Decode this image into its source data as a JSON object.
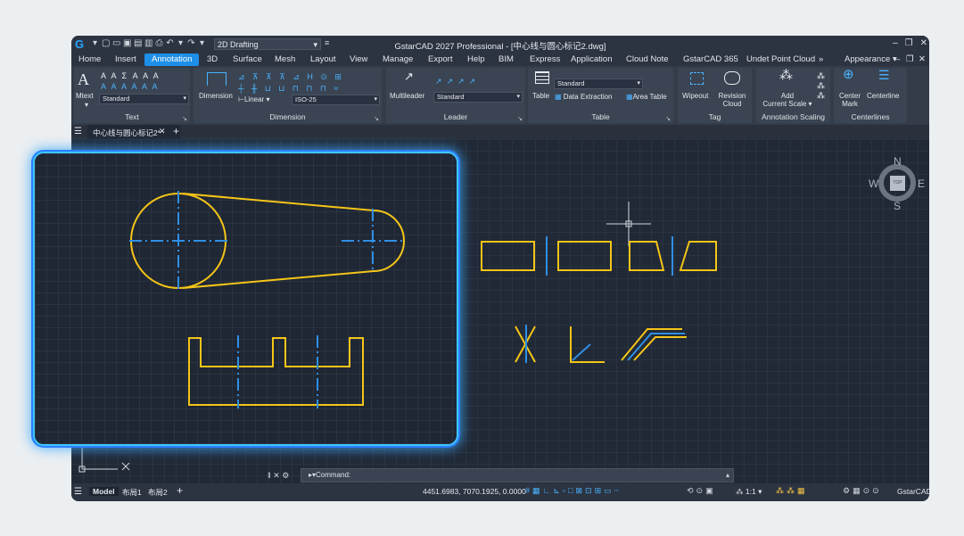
{
  "window": {
    "title": "GstarCAD 2027 Professional - [中心线与圆心标记2.dwg]",
    "workspace": "2D Drafting"
  },
  "menu_tabs": [
    {
      "label": "Home",
      "active": false
    },
    {
      "label": "Insert",
      "active": false
    },
    {
      "label": "Annotation",
      "active": true
    },
    {
      "label": "3D",
      "active": false
    },
    {
      "label": "Surface",
      "active": false
    },
    {
      "label": "Mesh",
      "active": false
    },
    {
      "label": "Layout",
      "active": false
    },
    {
      "label": "View",
      "active": false
    },
    {
      "label": "Manage",
      "active": false
    },
    {
      "label": "Export",
      "active": false
    },
    {
      "label": "Help",
      "active": false
    },
    {
      "label": "BIM",
      "active": false
    },
    {
      "label": "Express",
      "active": false
    },
    {
      "label": "Application",
      "active": false
    },
    {
      "label": "Cloud Note",
      "active": false
    },
    {
      "label": "GstarCAD 365",
      "active": false
    },
    {
      "label": "Undet Point Cloud",
      "active": false
    }
  ],
  "menu_right": {
    "appearance": "Appearance"
  },
  "ribbon": {
    "text": {
      "title": "Text",
      "mtext": "Mtext",
      "style": "Standard"
    },
    "dimension": {
      "title": "Dimension",
      "button": "Dimension",
      "linear": "Linear",
      "style": "ISO-25"
    },
    "leader": {
      "title": "Leader",
      "button": "Multileader",
      "style": "Standard"
    },
    "table": {
      "title": "Table",
      "button": "Table",
      "style": "Standard",
      "data_extraction": "Data Extraction",
      "area_table": "Area Table"
    },
    "tag": {
      "title": "Tag",
      "wipeout": "Wipeout",
      "revision_1": "Revision",
      "revision_2": "Cloud"
    },
    "scaling": {
      "title": "Annotation Scaling",
      "add_1": "Add",
      "add_2": "Current Scale"
    },
    "centerlines": {
      "title": "Centerlines",
      "center_1": "Center",
      "center_2": "Mark",
      "centerline": "Centerline"
    }
  },
  "doc_tab": {
    "label": "中心线与圆心标记2*"
  },
  "viewcube": {
    "n": "N",
    "s": "S",
    "w": "W",
    "e": "E",
    "top": "TOP"
  },
  "command": {
    "label": "Command:"
  },
  "status": {
    "model": "Model",
    "layout1": "布局1",
    "layout2": "布局2",
    "coords": "4451.6983, 7070.1925, 0.0000",
    "scale": "1:1",
    "brand": "GstarCAD"
  },
  "colors": {
    "accent": "#1e8fe8",
    "geometry": "#f5c518",
    "centerline": "#2f8fe6",
    "highlight": "#3ec6ff"
  }
}
